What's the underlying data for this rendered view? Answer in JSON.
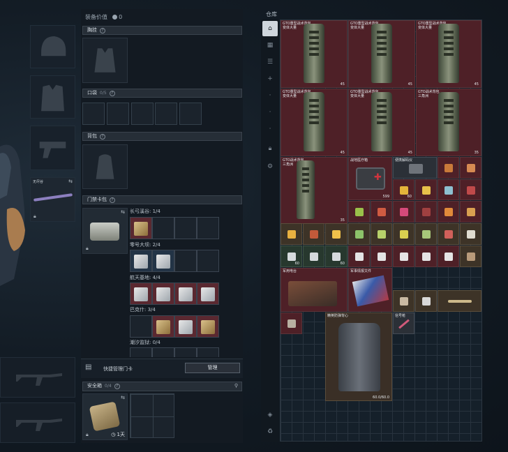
{
  "middle": {
    "header": {
      "label": "装备价值",
      "value": "0"
    },
    "chest": {
      "label": "胸挂"
    },
    "pockets": {
      "label": "口袋",
      "count": "0/5"
    },
    "backpack": {
      "label": "背包"
    },
    "keycard_bag": {
      "label": "门禁卡包",
      "rows": [
        {
          "name": "长弓溪谷: 1/4"
        },
        {
          "name": "零号大坝: 2/4"
        },
        {
          "name": "航天基地: 4/4"
        },
        {
          "name": "巴克什: 3/4"
        },
        {
          "name": "潮汐监狱: 0/4"
        }
      ]
    },
    "quick_manage": {
      "label": "快捷管理门卡",
      "button": "管理"
    },
    "safebox": {
      "label": "安全箱",
      "count": "0/4",
      "timer": "1天"
    },
    "slot_tag": "无尽谷"
  },
  "warehouse": {
    "title": "仓库",
    "tabs": [
      "warehouse-icon",
      "bag-icon",
      "list-icon",
      "plus-icon",
      "dot-icon",
      "dot-icon",
      "lock-icon",
      "gear-icon"
    ],
    "bottom_tabs": [
      "layers-icon",
      "recycle-icon"
    ],
    "items": {
      "backpack_name_line1": "GTO重型战术背包",
      "backpack_name_line2": "变体大量",
      "backpack_count": "45",
      "backpack_count_alt": "35",
      "backpack_tactical_name_line1": "GTO战术背包",
      "backpack_tactical_name_line2": "三角洲",
      "medkit_name": "战地医疗箱",
      "medkit_count": "599",
      "case_name": "便携解码仪",
      "case_count": "60",
      "drink_name": "能量饮料",
      "drink_count": "35",
      "card_name": "门禁卡",
      "card_count": "60",
      "electronics_name": "军用电台",
      "flag_box_name": "军事情报文件",
      "vest_name": "精英防弹背心",
      "vest_count": "60.0/60.0",
      "misc_name": "信号枪"
    }
  },
  "colors": {
    "item_red": "#4e2027",
    "item_dark": "#2b3037",
    "accent": "#cfd6dc"
  }
}
